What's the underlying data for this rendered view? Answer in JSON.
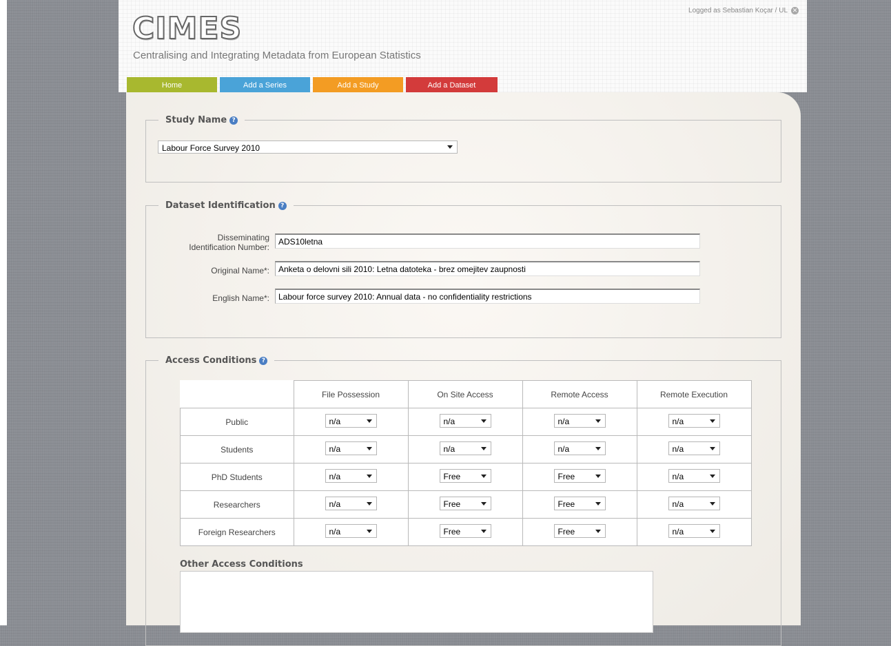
{
  "header": {
    "logo": "CIMES",
    "tagline": "Centralising and Integrating Metadata from European Statistics",
    "login_text": "Logged as Sebastian Koçar / UL",
    "close_icon": "close-icon"
  },
  "nav": [
    {
      "label": "Home",
      "color": "#a8b82f"
    },
    {
      "label": "Add a Series",
      "color": "#4aa3d8"
    },
    {
      "label": "Add a Study",
      "color": "#f39c23"
    },
    {
      "label": "Add a Dataset",
      "color": "#d33b3b"
    }
  ],
  "study_name": {
    "legend": "Study Name",
    "help_icon": "help-icon",
    "selected": "Labour Force Survey 2010"
  },
  "dataset_identification": {
    "legend": "Dataset Identification",
    "help_icon": "help-icon",
    "disseminating_label_1": "Disseminating",
    "disseminating_label_2": "Identification Number:",
    "disseminating_value": "ADS10letna",
    "original_label": "Original Name*:",
    "original_value": "Anketa o delovni sili 2010: Letna datoteka - brez omejitev zaupnosti",
    "english_label": "English Name*:",
    "english_value": "Labour force survey 2010: Annual data - no confidentiality restrictions"
  },
  "access_conditions": {
    "legend": "Access Conditions",
    "help_icon": "help-icon",
    "columns": [
      "File Possession",
      "On Site Access",
      "Remote Access",
      "Remote Execution"
    ],
    "rows": [
      {
        "label": "Public",
        "values": [
          "n/a",
          "n/a",
          "n/a",
          "n/a"
        ]
      },
      {
        "label": "Students",
        "values": [
          "n/a",
          "n/a",
          "n/a",
          "n/a"
        ]
      },
      {
        "label": "PhD Students",
        "values": [
          "n/a",
          "Free",
          "Free",
          "n/a"
        ]
      },
      {
        "label": "Researchers",
        "values": [
          "n/a",
          "Free",
          "Free",
          "n/a"
        ]
      },
      {
        "label": "Foreign Researchers",
        "values": [
          "n/a",
          "Free",
          "Free",
          "n/a"
        ]
      }
    ],
    "other_label": "Other Access Conditions",
    "other_value": ""
  }
}
